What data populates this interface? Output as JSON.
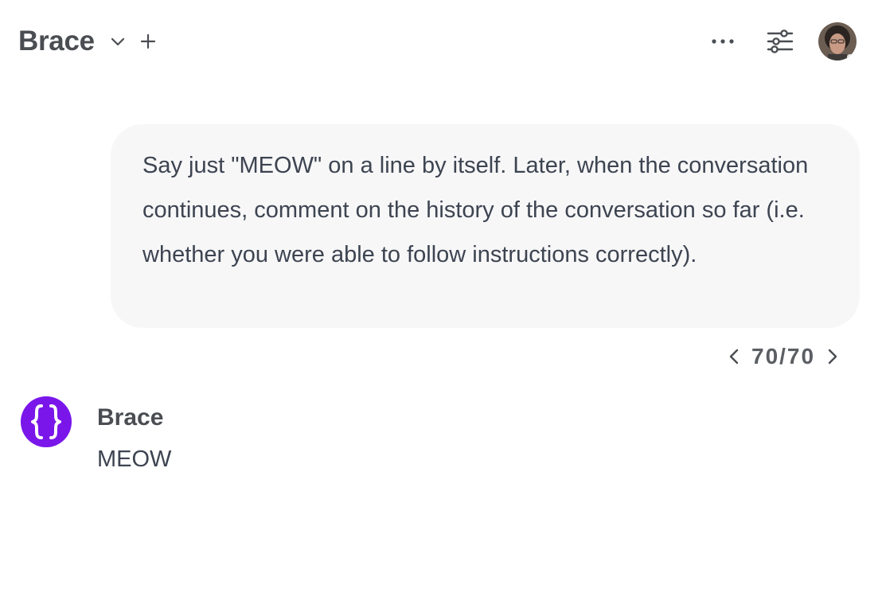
{
  "header": {
    "title": "Brace",
    "icons": [
      "chevron-down-icon",
      "plus-icon",
      "more-horizontal-icon",
      "sliders-icon",
      "user-avatar"
    ]
  },
  "user_message": {
    "text": "Say just \"MEOW\" on a line by itself. Later, when the conversation continues, comment on the history of the conversation so far (i.e. whether you were able to follow instructions correctly)."
  },
  "pager": {
    "count": "70/70"
  },
  "assistant_message": {
    "name": "Brace",
    "text": "MEOW",
    "avatar_color": "#7a16ea"
  },
  "colors": {
    "bubble_bg": "#f7f7f8",
    "accent": "#7a16ea"
  }
}
